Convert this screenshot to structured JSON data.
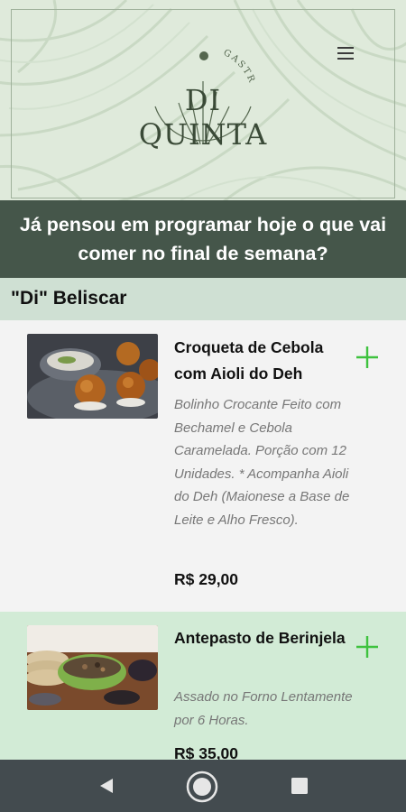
{
  "header": {
    "brand_top": "GASTRONOMIA",
    "brand_name": "DI QUINTA",
    "menu_icon": "hamburger-menu-icon"
  },
  "banner": {
    "text": "Já pensou em programar hoje o que vai comer no final de semana?"
  },
  "section": {
    "title": "\"Di\" Beliscar"
  },
  "items": [
    {
      "name": "Croqueta de Cebola com Aioli do Deh",
      "description": "Bolinho Crocante Feito com Bechamel e Cebola Caramelada. Porção com 12 Unidades. * Acompanha Aioli do Deh (Maionese a Base de Leite e Alho Fresco).",
      "price": "R$ 29,00",
      "add_icon": "plus-icon"
    },
    {
      "name": "Antepasto de Berinjela",
      "description": "Assado no Forno Lentamente por 6 Horas.",
      "price": "R$ 35,00",
      "add_icon": "plus-icon"
    }
  ],
  "navbar": {
    "back_icon": "back-triangle-icon",
    "home_icon": "home-circle-icon",
    "recent_icon": "recent-square-icon"
  },
  "colors": {
    "header_bg": "#dfeadb",
    "banner_bg": "#45564a",
    "section_bg": "#cfe0d3",
    "item_alt_bg": "#d2ebd6",
    "accent_plus": "#3ec23e",
    "navbar_bg": "#434b4f"
  }
}
